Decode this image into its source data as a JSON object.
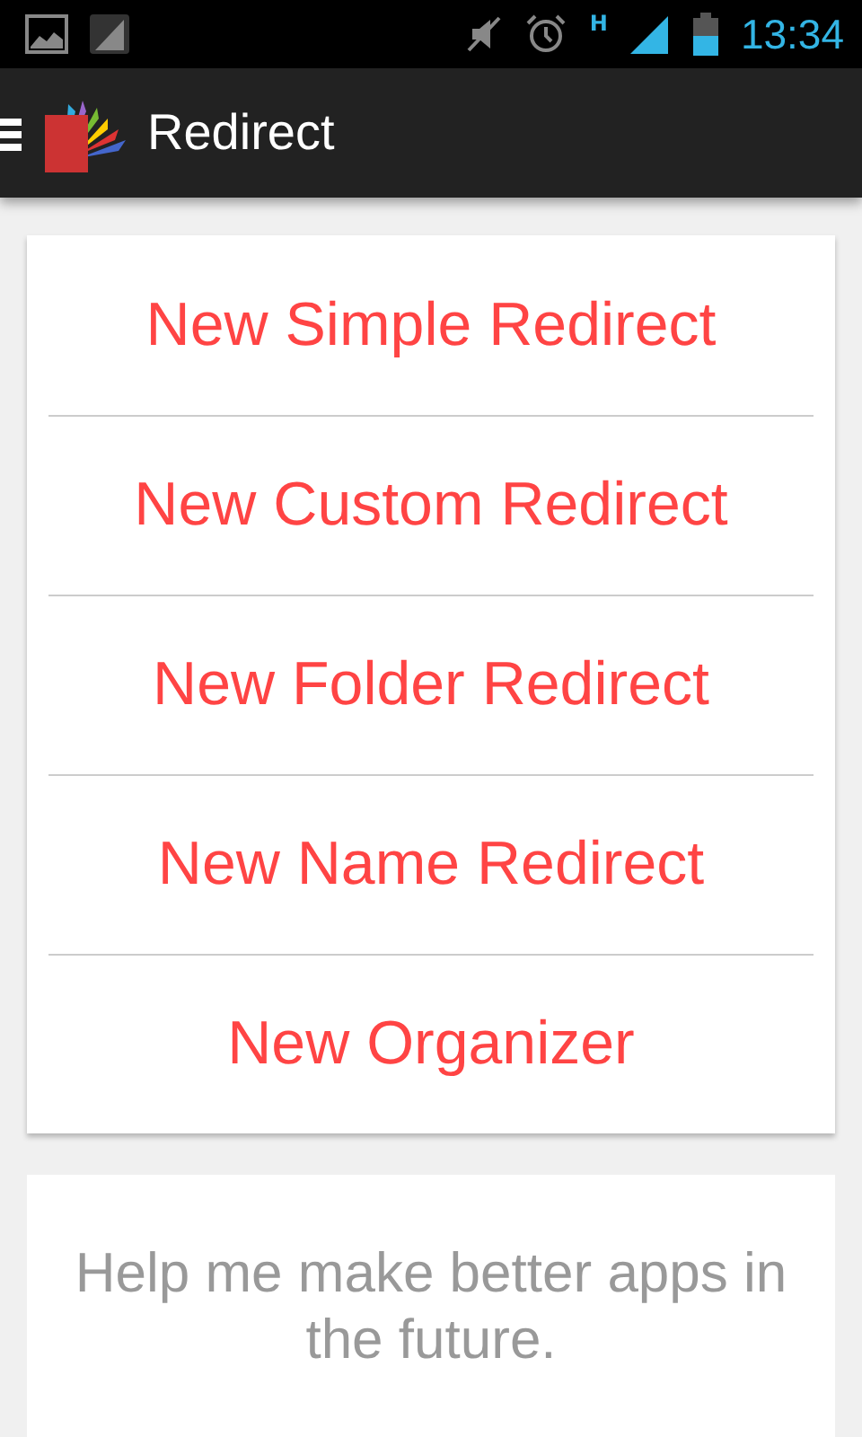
{
  "status_bar": {
    "network_type": "H",
    "time": "13:34"
  },
  "app_bar": {
    "title": "Redirect"
  },
  "actions": [
    "New Simple Redirect",
    "New Custom Redirect",
    "New Folder Redirect",
    "New Name Redirect",
    "New Organizer"
  ],
  "help_card": {
    "text": "Help me make better apps in the future."
  }
}
